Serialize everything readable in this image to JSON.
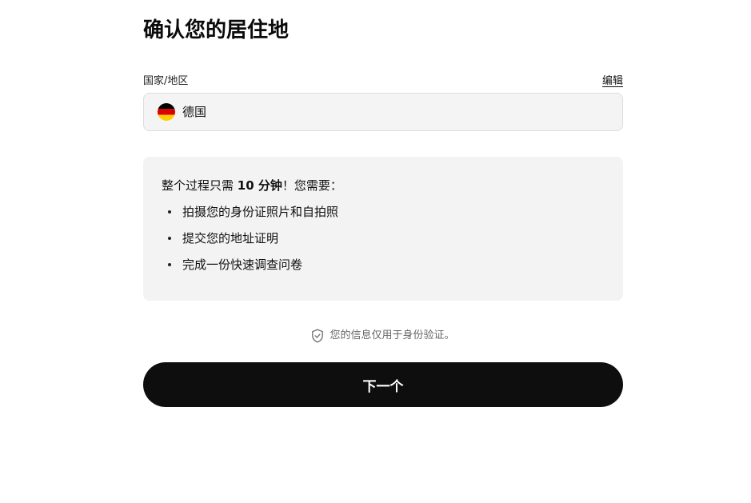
{
  "page": {
    "title": "确认您的居住地"
  },
  "country_field": {
    "label": "国家/地区",
    "edit_label": "编辑",
    "value": "德国",
    "flag_icon": "germany-flag-icon",
    "flag_colors": [
      "#000000",
      "#dd0000",
      "#ffce00"
    ]
  },
  "info_box": {
    "intro_prefix": "整个过程只需 ",
    "intro_bold": "10 分钟",
    "intro_suffix": "！您需要：",
    "items": [
      "拍摄您的身份证照片和自拍照",
      "提交您的地址证明",
      "完成一份快速调查问卷"
    ]
  },
  "privacy": {
    "icon": "shield-check-icon",
    "text": "您的信息仅用于身份验证。"
  },
  "actions": {
    "next_label": "下一个"
  },
  "colors": {
    "button_bg": "#0e0e0e",
    "field_bg": "#f4f4f4",
    "info_bg": "#f3f3f3"
  }
}
